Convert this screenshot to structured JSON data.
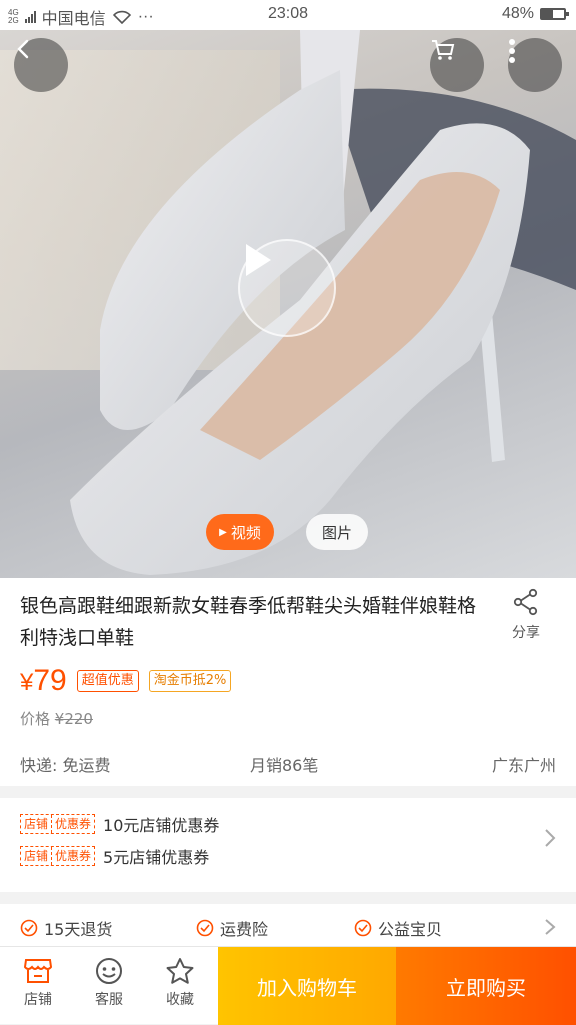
{
  "status_bar": {
    "network": "4G\n2G",
    "carrier": "中国电信",
    "dots": "···",
    "time": "23:08",
    "battery": "48%",
    "battery_level": 0.48
  },
  "media": {
    "tab_video": "视频",
    "tab_photo": "图片"
  },
  "product": {
    "title": "银色高跟鞋细跟新款女鞋春季低帮鞋尖头婚鞋伴娘鞋格利特浅口单鞋",
    "share_label": "分享",
    "currency": "¥",
    "price": "79",
    "badge_deal": "超值优惠",
    "badge_taojin": "淘金币抵2%",
    "orig_label": "价格",
    "orig_price": "¥220",
    "shipping": "快递: 免运费",
    "monthly_sales": "月销86笔",
    "location": "广东广州"
  },
  "coupons": {
    "tag_shop": "店铺",
    "tag_coupon": "优惠券",
    "items": [
      "10元店铺优惠券",
      "5元店铺优惠券"
    ]
  },
  "services": [
    "15天退货",
    "运费险",
    "公益宝贝"
  ],
  "bottom_bar": {
    "shop": "店铺",
    "service": "客服",
    "favorite": "收藏",
    "add_to_cart": "加入购物车",
    "buy_now": "立即购买"
  },
  "colors": {
    "accent": "#ff5000",
    "cart_button": "#ffb300",
    "buy_button": "#ff5f00"
  },
  "icons": [
    "back-icon",
    "cart-icon",
    "more-icon",
    "play-icon",
    "share-icon",
    "store-icon",
    "customer-service-icon",
    "star-icon",
    "check-circle-icon",
    "chevron-right-icon"
  ]
}
